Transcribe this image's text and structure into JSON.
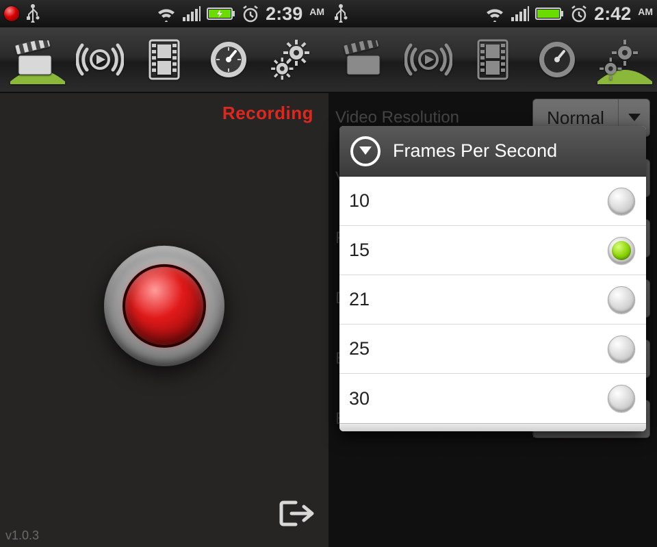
{
  "left": {
    "status": {
      "time": "2:39",
      "ampm": "AM",
      "show_rec_dot": true
    },
    "recording_label": "Recording",
    "version": "v1.0.3"
  },
  "right": {
    "status": {
      "time": "2:42",
      "ampm": "AM",
      "show_rec_dot": false
    },
    "settings": {
      "rows": [
        {
          "label": "Video Resolution",
          "value": "Normal"
        },
        {
          "label": "V"
        },
        {
          "label": "Fr"
        },
        {
          "label": "D"
        },
        {
          "label": "E"
        },
        {
          "label": "E"
        }
      ]
    },
    "dialog": {
      "title": "Frames Per Second",
      "options": [
        {
          "label": "10",
          "selected": false
        },
        {
          "label": "15",
          "selected": true
        },
        {
          "label": "21",
          "selected": false
        },
        {
          "label": "25",
          "selected": false
        },
        {
          "label": "30",
          "selected": false
        }
      ]
    }
  },
  "toolbar_icons": [
    "clapper",
    "live-play",
    "filmstrip",
    "gauge",
    "gears"
  ]
}
